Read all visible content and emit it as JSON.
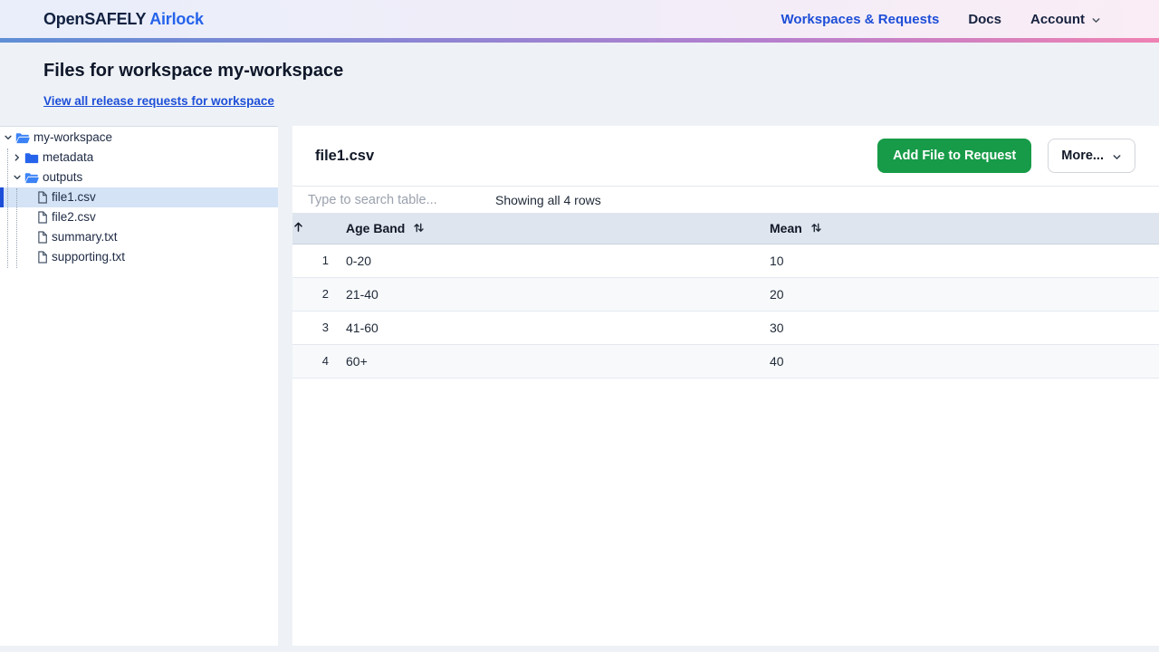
{
  "topnav": {
    "brand_primary": "OpenSAFELY",
    "brand_secondary": "Airlock",
    "link_workspaces": "Workspaces & Requests",
    "link_docs": "Docs",
    "link_account": "Account"
  },
  "page_header": {
    "title": "Files for workspace my-workspace",
    "link": "View all release requests for workspace"
  },
  "sidebar": {
    "tree": [
      {
        "label": "my-workspace",
        "type": "folder-open",
        "depth": 0,
        "expanded": true
      },
      {
        "label": "metadata",
        "type": "folder-closed",
        "depth": 1,
        "expanded": false
      },
      {
        "label": "outputs",
        "type": "folder-open",
        "depth": 1,
        "expanded": true
      },
      {
        "label": "file1.csv",
        "type": "file",
        "depth": 2,
        "selected": true
      },
      {
        "label": "file2.csv",
        "type": "file",
        "depth": 2,
        "selected": false
      },
      {
        "label": "summary.txt",
        "type": "file",
        "depth": 2,
        "selected": false
      },
      {
        "label": "supporting.txt",
        "type": "file",
        "depth": 2,
        "selected": false
      }
    ]
  },
  "file_panel": {
    "title": "file1.csv",
    "add_button_label": "Add File to Request",
    "more_button_label": "More...",
    "search_placeholder": "Type to search table...",
    "row_count_text": "Showing all 4 rows"
  },
  "table": {
    "sort": {
      "column": "row-number",
      "direction": "ascending"
    },
    "columns": [
      {
        "label": "Age Band",
        "sortable": true
      },
      {
        "label": "Mean",
        "sortable": true
      }
    ],
    "rows": [
      {
        "num": "1",
        "age_band": "0-20",
        "mean": "10"
      },
      {
        "num": "2",
        "age_band": "21-40",
        "mean": "20"
      },
      {
        "num": "3",
        "age_band": "41-60",
        "mean": "30"
      },
      {
        "num": "4",
        "age_band": "60+",
        "mean": "40"
      }
    ]
  },
  "colors": {
    "brand_navy": "#122141",
    "brand_blue": "#2563eb",
    "link_blue": "#1d4ed8",
    "button_green": "#179b48",
    "selected_tree_bg": "#d4e3f6",
    "selected_tree_bar": "#1d4ed8",
    "table_header_bg": "#dfe5ee",
    "page_bg": "#eef2f6"
  }
}
